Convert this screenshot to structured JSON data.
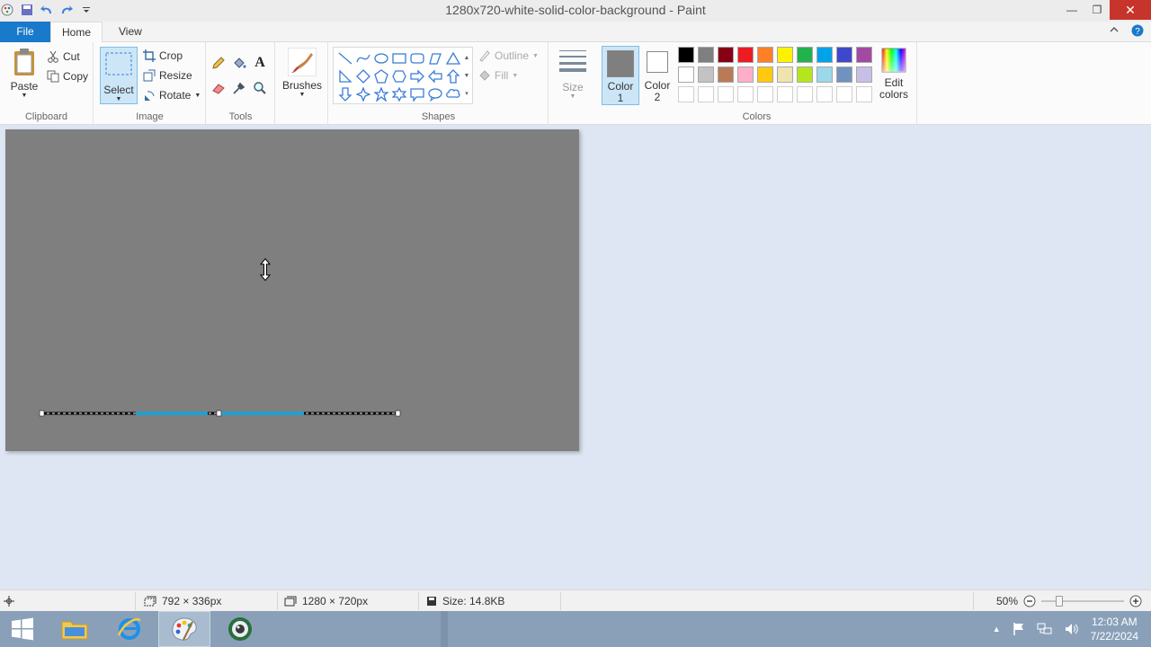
{
  "window": {
    "title": "1280x720-white-solid-color-background - Paint",
    "minimize": "—",
    "restore": "❐",
    "close": "✕"
  },
  "tabs": {
    "file": "File",
    "home": "Home",
    "view": "View"
  },
  "ribbon": {
    "clipboard": {
      "label": "Clipboard",
      "paste": "Paste",
      "cut": "Cut",
      "copy": "Copy"
    },
    "image": {
      "label": "Image",
      "select": "Select",
      "crop": "Crop",
      "resize": "Resize",
      "rotate": "Rotate"
    },
    "tools": {
      "label": "Tools"
    },
    "brushes": {
      "label": "Brushes"
    },
    "shapes": {
      "label": "Shapes",
      "outline": "Outline",
      "fill": "Fill"
    },
    "size": {
      "label": "Size"
    },
    "colors": {
      "label": "Colors",
      "color1": "Color 1",
      "color1_line1": "Color",
      "color1_line2": "1",
      "color2_line1": "Color",
      "color2_line2": "2",
      "edit_line1": "Edit",
      "edit_line2": "colors",
      "color1_value": "#7f7f7f",
      "color2_value": "#ffffff",
      "palette_row1": [
        "#000000",
        "#7f7f7f",
        "#880015",
        "#ed1c24",
        "#ff7f27",
        "#fff200",
        "#22b14c",
        "#00a2e8",
        "#3f48cc",
        "#a349a4"
      ],
      "palette_row2": [
        "#ffffff",
        "#c3c3c3",
        "#b97a57",
        "#ffaec9",
        "#ffc90e",
        "#efe4b0",
        "#b5e61d",
        "#99d9ea",
        "#7092be",
        "#c8bfe7"
      ],
      "palette_row3": [
        "#ffffff",
        "#ffffff",
        "#ffffff",
        "#ffffff",
        "#ffffff",
        "#ffffff",
        "#ffffff",
        "#ffffff",
        "#ffffff",
        "#ffffff"
      ]
    }
  },
  "canvas": {
    "color": "#7f7f7f"
  },
  "status": {
    "selection_size": "792 × 336px",
    "image_size": "1280 × 720px",
    "file_size": "Size: 14.8KB",
    "zoom": "50%"
  },
  "taskbar": {
    "time": "12:03 AM",
    "date": "7/22/2024"
  }
}
